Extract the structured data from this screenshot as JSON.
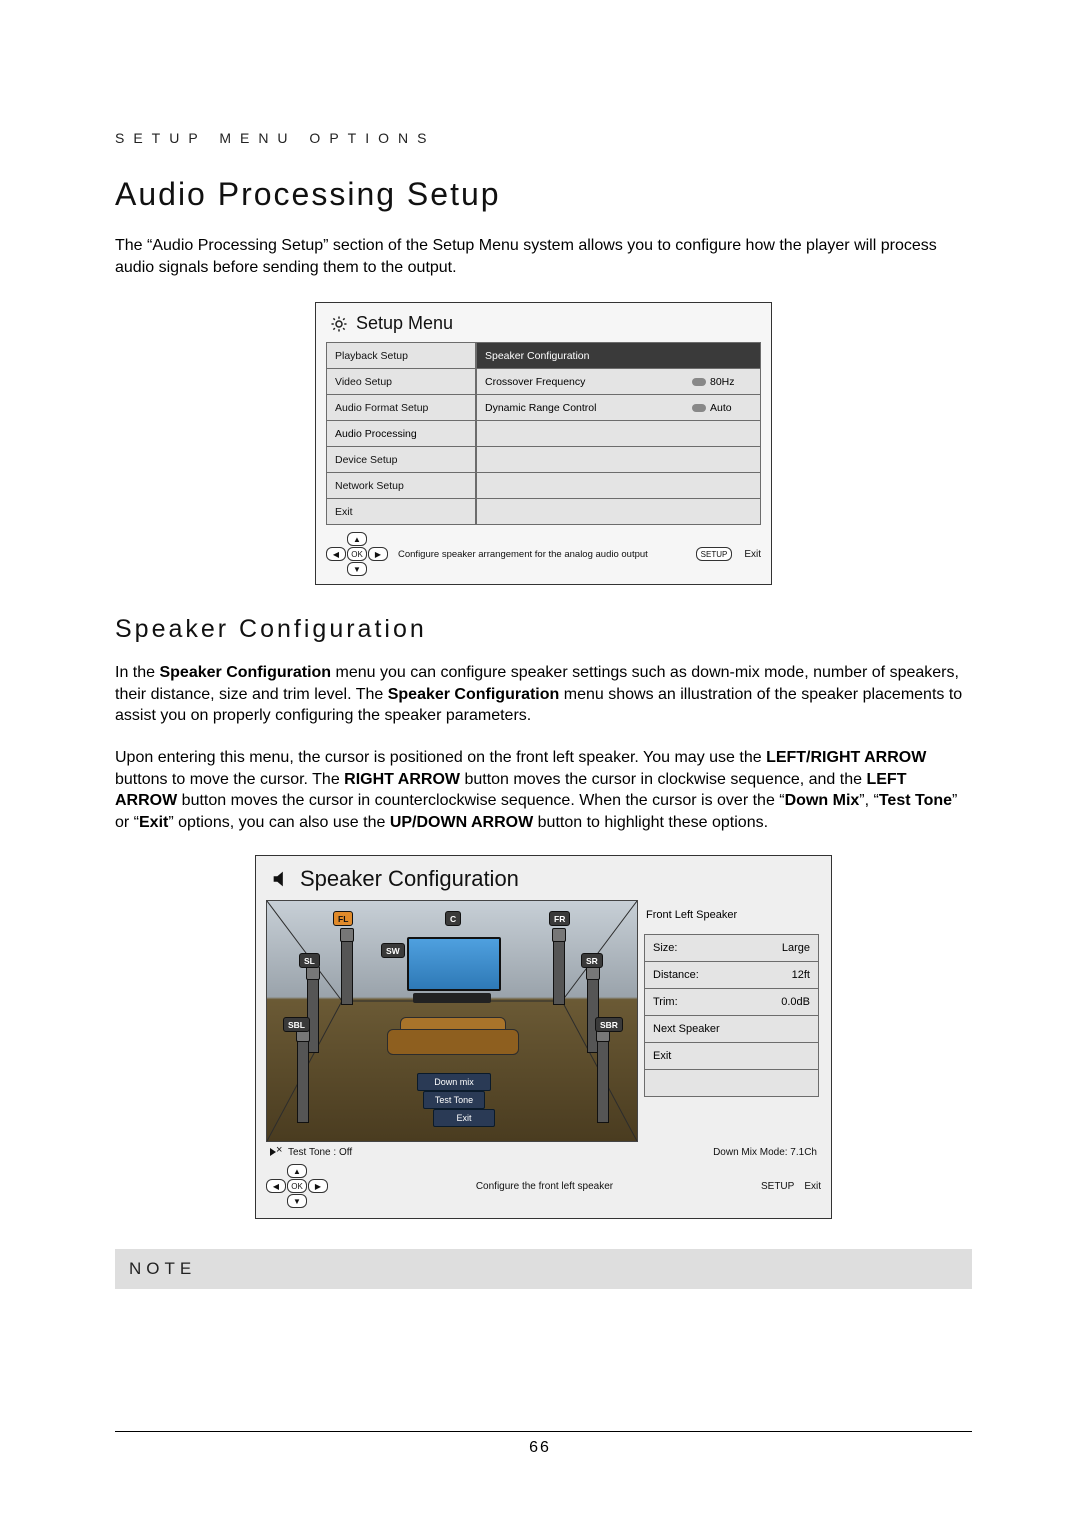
{
  "kicker": "SETUP MENU OPTIONS",
  "title": "Audio Processing Setup",
  "intro": "The “Audio Processing Setup” section of the Setup Menu system allows you to configure how the player will process audio signals before sending them to the output.",
  "menu": {
    "heading": "Setup Menu",
    "left": [
      "Playback Setup",
      "Video Setup",
      "Audio Format Setup",
      "Audio Processing",
      "Device Setup",
      "Network Setup",
      "Exit"
    ],
    "right": [
      {
        "k": "Speaker Configuration",
        "v": ""
      },
      {
        "k": "Crossover Frequency",
        "v": "80Hz"
      },
      {
        "k": "Dynamic Range Control",
        "v": "Auto"
      }
    ],
    "hint": "Configure speaker arrangement for the analog audio output",
    "nav": {
      "up": "▲",
      "left": "◀",
      "ok": "OK",
      "right": "▶",
      "down": "▼"
    },
    "setup_btn": "SETUP",
    "setup_exit": "Exit"
  },
  "section2_title": "Speaker Configuration",
  "para2_parts": {
    "a": "In the ",
    "b": "Speaker Configuration",
    "c": " menu you can configure speaker settings such as down-mix mode, number of speakers, their distance, size and trim level.  The ",
    "d": "Speaker Configuration",
    "e": " menu shows an illustration of the speaker placements to assist you on properly configuring the speaker parameters."
  },
  "para3_parts": {
    "a": "Upon entering this menu, the cursor is positioned on the front left speaker.  You may use the ",
    "b": "LEFT/RIGHT ARROW",
    "c": " buttons to move the cursor.  The ",
    "d": "RIGHT ARROW",
    "e": " button moves the cursor in clockwise sequence, and the ",
    "f": "LEFT ARROW",
    "g": " button moves the cursor in counterclockwise sequence.  When the cursor is over the “",
    "h": "Down Mix",
    "i": "”, “",
    "j": "Test Tone",
    "k": "” or “",
    "l": "Exit",
    "m": "” options, you can also use the ",
    "n": "UP/DOWN ARROW",
    "o": " button to highlight these options."
  },
  "spk": {
    "title": "Speaker Configuration",
    "labels": {
      "FL": "FL",
      "C": "C",
      "FR": "FR",
      "SW": "SW",
      "SL": "SL",
      "SR": "SR",
      "SBL": "SBL",
      "SBR": "SBR"
    },
    "buttons": {
      "downmix": "Down mix",
      "testtone": "Test Tone",
      "exit": "Exit"
    },
    "status": {
      "testtone": "Test Tone : Off",
      "downmixmode": "Down Mix Mode: 7.1Ch"
    },
    "right": {
      "head": "Front Left Speaker",
      "rows": [
        {
          "k": "Size:",
          "v": "Large"
        },
        {
          "k": "Distance:",
          "v": "12ft"
        },
        {
          "k": "Trim:",
          "v": "0.0dB"
        },
        {
          "k": "Next Speaker",
          "v": ""
        },
        {
          "k": "Exit",
          "v": ""
        }
      ]
    },
    "hint": "Configure the front left speaker",
    "setup_btn": "SETUP",
    "setup_exit": "Exit"
  },
  "note_label": "NOTE",
  "page_number": "66"
}
